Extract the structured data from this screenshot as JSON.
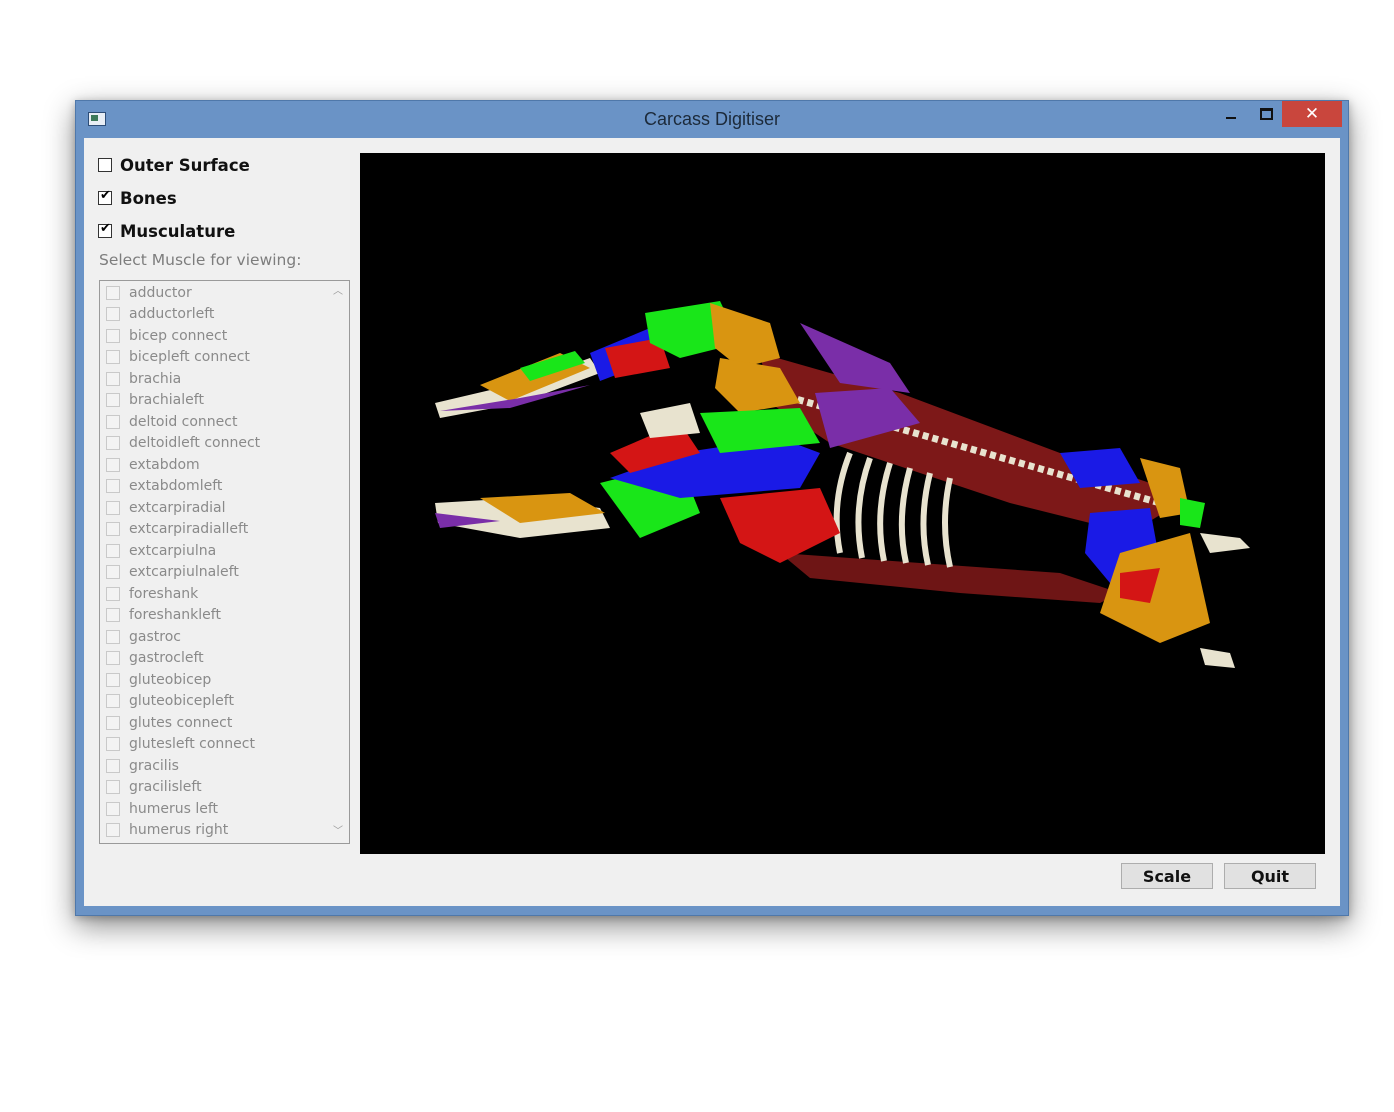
{
  "window": {
    "title": "Carcass Digitiser",
    "close_glyph": "✕"
  },
  "layers": [
    {
      "label": "Outer Surface",
      "checked": false
    },
    {
      "label": "Bones",
      "checked": true
    },
    {
      "label": "Musculature",
      "checked": true
    }
  ],
  "muscle_select": {
    "label": "Select Muscle for viewing:",
    "items": [
      "adductor",
      "adductorleft",
      "bicep connect",
      "bicepleft connect",
      "brachia",
      "brachialeft",
      "deltoid connect",
      "deltoidleft connect",
      "extabdom",
      "extabdomleft",
      "extcarpiradial",
      "extcarpiradialleft",
      "extcarpiulna",
      "extcarpiulnaleft",
      "foreshank",
      "foreshankleft",
      "gastroc",
      "gastrocleft",
      "gluteobicep",
      "gluteobicepleft",
      "glutes connect",
      "glutesleft connect",
      "gracilis",
      "gracilisleft",
      "humerus left",
      "humerus right"
    ],
    "scroll_up_glyph": "︿",
    "scroll_down_glyph": "﹀"
  },
  "buttons": {
    "scale": "Scale",
    "quit": "Quit"
  },
  "viewport": {
    "background": "#000000",
    "model_colors": {
      "bone": "#e8e3cf",
      "muscle_green": "#19e619",
      "muscle_blue": "#1a1ae6",
      "muscle_red": "#d41515",
      "muscle_orange": "#d99511",
      "muscle_purple": "#7a2ea8",
      "muscle_maroon": "#7d1818"
    }
  }
}
